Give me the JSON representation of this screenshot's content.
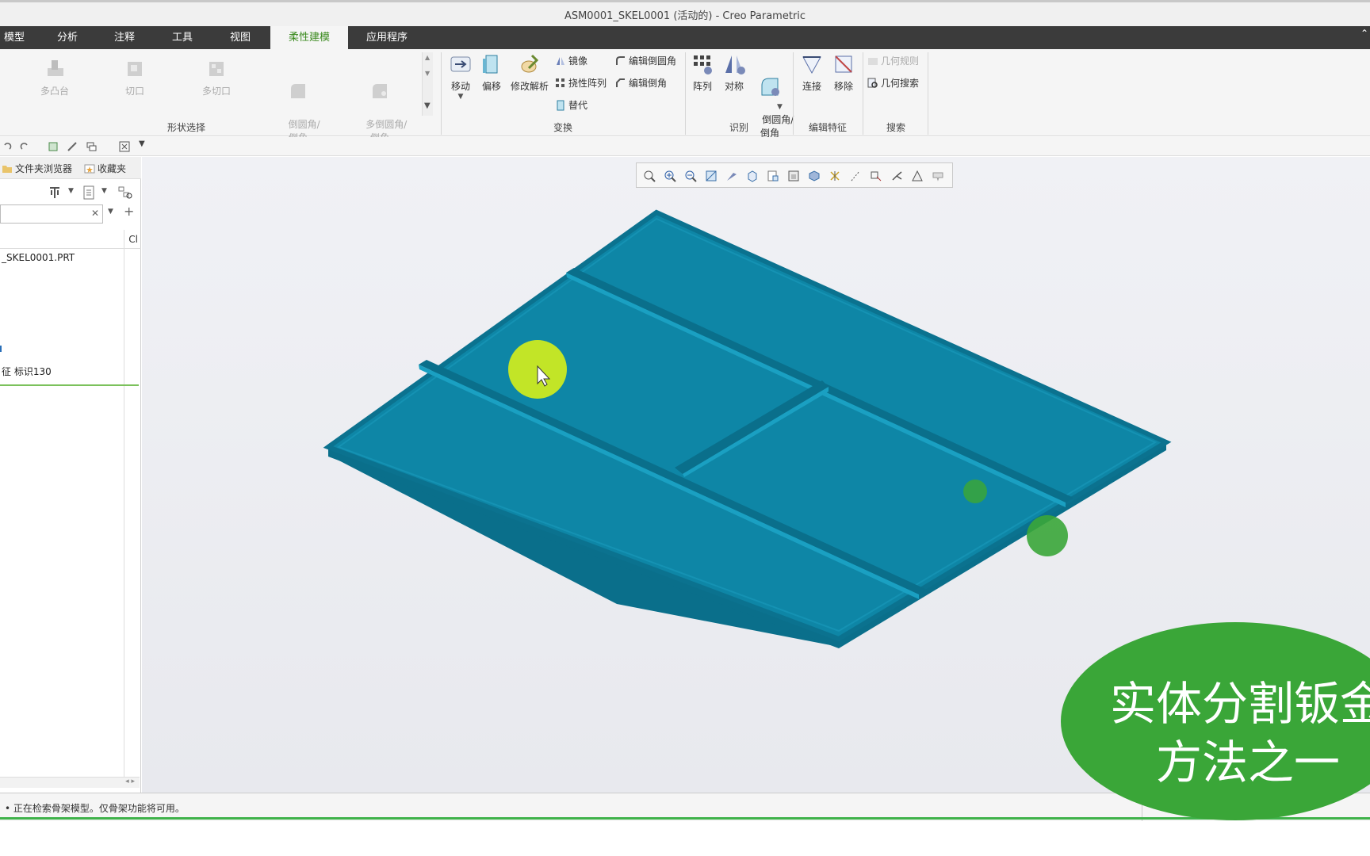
{
  "window": {
    "title": "ASM0001_SKEL0001 (活动的) - Creo Parametric"
  },
  "tabs": [
    {
      "label": "模型"
    },
    {
      "label": "分析"
    },
    {
      "label": "注释"
    },
    {
      "label": "工具"
    },
    {
      "label": "视图"
    },
    {
      "label": "柔性建模",
      "active": true
    },
    {
      "label": "应用程序"
    }
  ],
  "ribbon": {
    "shape_select": {
      "label": "形状选择",
      "items": [
        "多凸台",
        "切口",
        "多切口",
        "倒圆角/\n倒角",
        "多倒圆角/\n倒角"
      ]
    },
    "transform": {
      "label": "变换",
      "move": "移动",
      "offset": "偏移",
      "modify_analytic": "修改解析",
      "mirror": "镜像",
      "flex_pattern": "挠性阵列",
      "substitute": "替代",
      "edit_round": "编辑倒圆角",
      "edit_chamfer": "编辑倒角"
    },
    "recognize": {
      "label": "识别",
      "pattern": "阵列",
      "symmetry": "对称",
      "round_chamfer": "倒圆角/\n倒角"
    },
    "edit_features": {
      "label": "编辑特征",
      "attach": "连接",
      "remove": "移除"
    },
    "search": {
      "label": "搜索",
      "geometry_rules": "几何规则",
      "geometry_search": "几何搜索"
    }
  },
  "left_panel": {
    "tab_folder_browser": "文件夹浏览器",
    "tab_favorites": "收藏夹",
    "column_header": "Cl",
    "tree_items": [
      "_SKEL0001.PRT",
      "征 标识130"
    ]
  },
  "status": {
    "message": "• 正在检索骨架模型。仅骨架功能将可用。"
  },
  "overlay": {
    "line1": "实体分割钣金",
    "line2": "方法之一"
  },
  "colors": {
    "model_top": "#0e86a6",
    "model_edge": "#0a6f8b",
    "tab_bar": "#3b3b3b",
    "active_tab_text": "#3a8a1e",
    "overlay": "#3aa638"
  }
}
